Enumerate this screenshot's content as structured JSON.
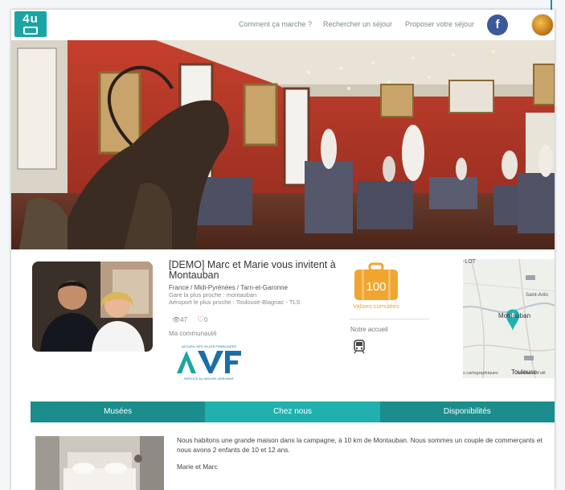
{
  "header": {
    "logo_text": "4u",
    "nav": [
      "Comment ça marche ?",
      "Rechercher un séjour",
      "Proposer votre séjour"
    ],
    "facebook_letter": "f"
  },
  "profile": {
    "title": "[DEMO] Marc et Marie vous invitent à Montauban",
    "location": "France / Midi-Pyrénées / Tarn-et-Garonne",
    "station": "Gare la plus proche : montauban",
    "airport": "Aéroport le plus proche : Toulouse-Blagnac - TLS",
    "views": "47",
    "likes": "0",
    "community_label": "Ma communauté",
    "avf_top": "ACCUEIL DES VILLES FRANÇAISES",
    "avf_bottom": "SERVICE AU NOUVEL ARRIVANT"
  },
  "stats": {
    "suitcase_number": "100",
    "suitcase_label": "Valises cumulées",
    "accueil_label": "Notre accueil",
    "accent": "#f0a531"
  },
  "map": {
    "labels": [
      "-LOT",
      "Saint-Anto",
      "Montauban",
      "Toulouse",
      "s cartographiques",
      "Conditions d'util"
    ]
  },
  "tabs": [
    {
      "label": "Musées",
      "active": false
    },
    {
      "label": "Chez nous",
      "active": true
    },
    {
      "label": "Disponibilités",
      "active": false
    }
  ],
  "content": {
    "description": "Nous habitons une grande maison dans la campagne, à 10 km de Montauban. Nous sommes un couple de commerçants et nous avons 2 enfants de 10 et 12 ans.",
    "signature": "Marie et Marc"
  },
  "colors": {
    "teal": "#1aa5a4",
    "tab_active": "#20b1ae",
    "tab": "#1a8d8c",
    "facebook": "#3b5998",
    "heart": "#e0524d"
  }
}
